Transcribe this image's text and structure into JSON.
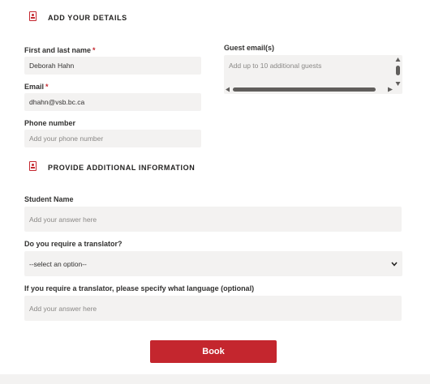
{
  "details_section": {
    "title": "ADD YOUR DETAILS"
  },
  "fields": {
    "name": {
      "label": "First and last name",
      "required": "*",
      "value": "Deborah Hahn"
    },
    "email": {
      "label": "Email",
      "required": "*",
      "value": "dhahn@vsb.bc.ca"
    },
    "phone": {
      "label": "Phone number",
      "placeholder": "Add your phone number"
    },
    "guests": {
      "label": "Guest email(s)",
      "placeholder": "Add up to 10 additional guests"
    }
  },
  "additional_section": {
    "title": "PROVIDE ADDITIONAL INFORMATION"
  },
  "questions": {
    "student_name": {
      "label": "Student Name",
      "placeholder": "Add your answer here"
    },
    "translator": {
      "label": "Do you require a translator?",
      "selected": "--select an option--"
    },
    "language": {
      "label": "If you require a translator, please specify what language (optional)",
      "placeholder": "Add your answer here"
    }
  },
  "book_button": {
    "label": "Book"
  },
  "colors": {
    "accent": "#c4262e",
    "field_bg": "#f3f2f1"
  },
  "icons": {
    "section": "person-card-icon",
    "select": "chevron-down-icon"
  }
}
